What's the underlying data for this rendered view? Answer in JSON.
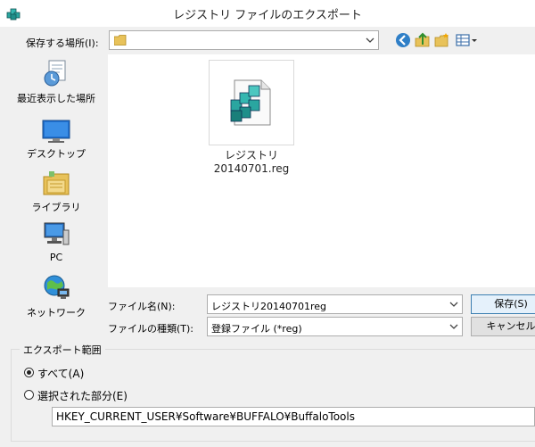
{
  "window": {
    "title": "レジストリ ファイルのエクスポート"
  },
  "location": {
    "label": "保存する場所(I):",
    "value": ""
  },
  "places": [
    {
      "label": "最近表示した場所",
      "icon": "recent-places-icon"
    },
    {
      "label": "デスクトップ",
      "icon": "desktop-icon"
    },
    {
      "label": "ライブラリ",
      "icon": "libraries-icon"
    },
    {
      "label": "PC",
      "icon": "computer-icon"
    },
    {
      "label": "ネットワーク",
      "icon": "network-icon"
    }
  ],
  "files": [
    {
      "name_line1": "レジストリ",
      "name_line2": "20140701.reg",
      "icon": "registry-file-icon"
    }
  ],
  "filename": {
    "label": "ファイル名(N):",
    "value": "レジストリ20140701reg"
  },
  "filetype": {
    "label": "ファイルの種類(T):",
    "value": "登録ファイル (*reg)"
  },
  "buttons": {
    "save": "保存(S)",
    "cancel": "キャンセル"
  },
  "export_range": {
    "title": "エクスポート範囲",
    "option_all": "すべて(A)",
    "option_selected": "選択された部分(E)",
    "selected": "all",
    "branch_value": "HKEY_CURRENT_USER¥Software¥BUFFALO¥BuffaloTools"
  },
  "colors": {
    "folder": "#e8c25a",
    "accent": "#3c7fb1",
    "registry": "#2aa6a0"
  }
}
